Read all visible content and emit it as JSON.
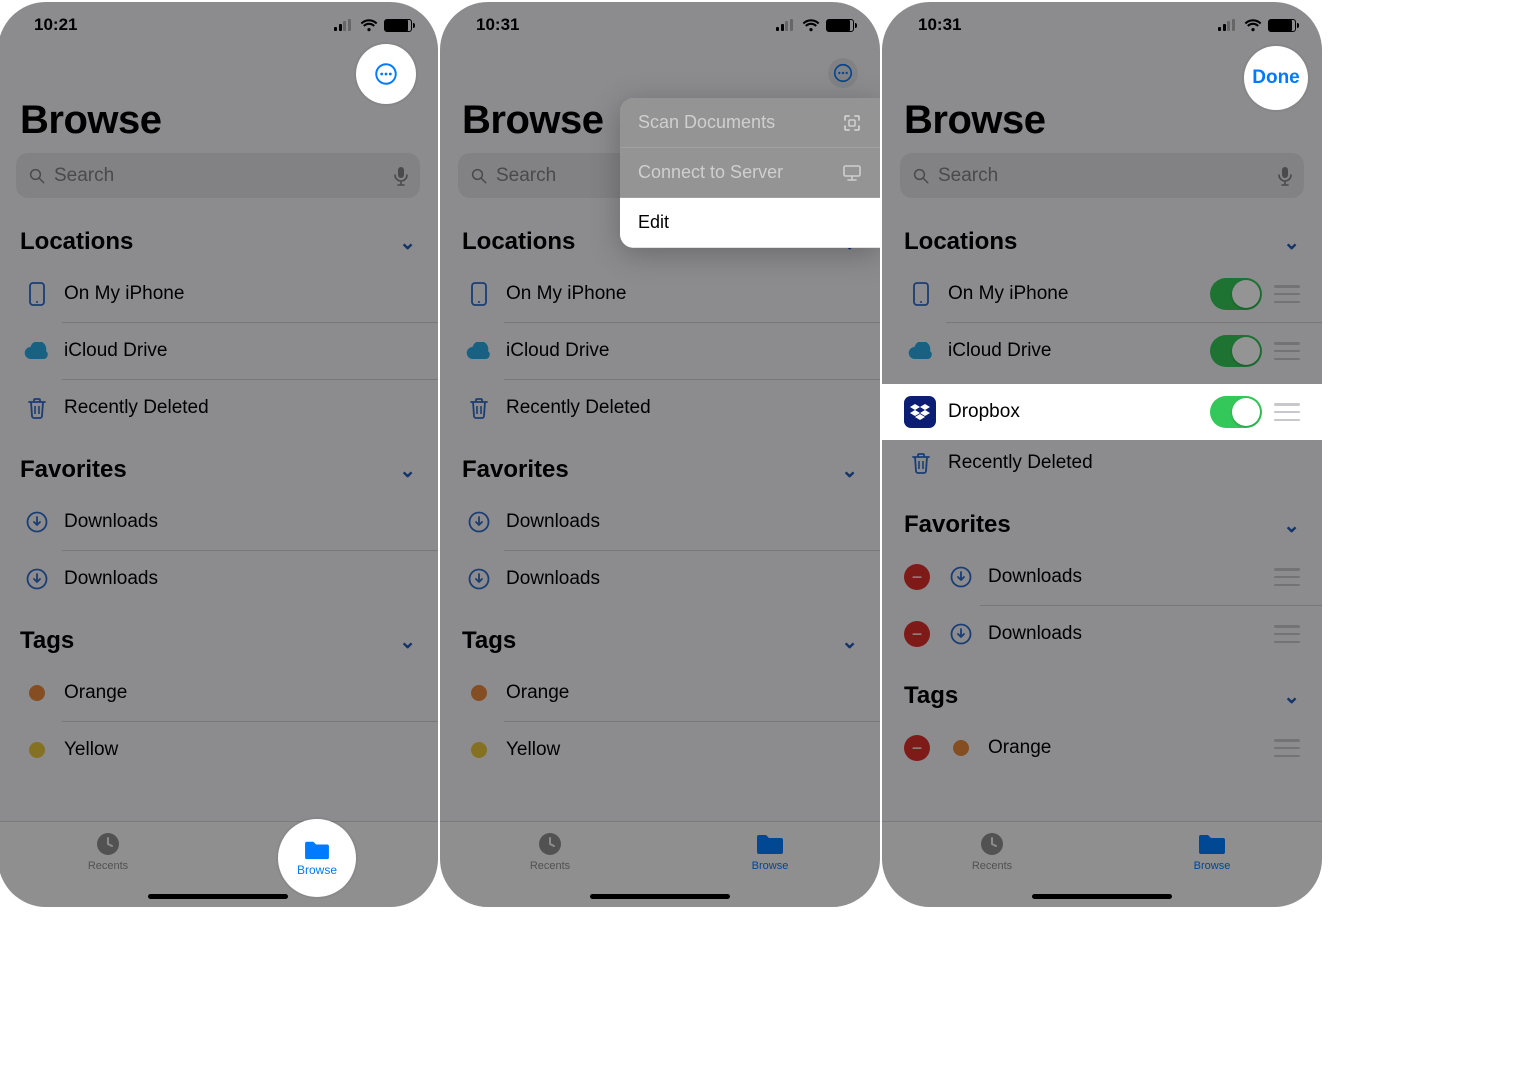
{
  "panel1": {
    "time": "10:21",
    "title": "Browse",
    "search_placeholder": "Search",
    "sections": {
      "locations": {
        "header": "Locations",
        "items": [
          {
            "label": "On My iPhone"
          },
          {
            "label": "iCloud Drive"
          },
          {
            "label": "Recently Deleted"
          }
        ]
      },
      "favorites": {
        "header": "Favorites",
        "items": [
          {
            "label": "Downloads"
          },
          {
            "label": "Downloads"
          }
        ]
      },
      "tags": {
        "header": "Tags",
        "items": [
          {
            "label": "Orange",
            "color": "#e6853c"
          },
          {
            "label": "Yellow",
            "color": "#e6c33c"
          }
        ]
      }
    },
    "tabs": {
      "recents": "Recents",
      "browse": "Browse"
    }
  },
  "panel2": {
    "time": "10:31",
    "title": "Browse",
    "search_placeholder": "Search",
    "menu": {
      "scan": "Scan Documents",
      "connect": "Connect to Server",
      "edit": "Edit"
    },
    "sections": {
      "locations": {
        "header": "Locations",
        "items": [
          {
            "label": "On My iPhone"
          },
          {
            "label": "iCloud Drive"
          },
          {
            "label": "Recently Deleted"
          }
        ]
      },
      "favorites": {
        "header": "Favorites",
        "items": [
          {
            "label": "Downloads"
          },
          {
            "label": "Downloads"
          }
        ]
      },
      "tags": {
        "header": "Tags",
        "items": [
          {
            "label": "Orange",
            "color": "#e6853c"
          },
          {
            "label": "Yellow",
            "color": "#e6c33c"
          }
        ]
      }
    },
    "tabs": {
      "recents": "Recents",
      "browse": "Browse"
    }
  },
  "panel3": {
    "time": "10:31",
    "title": "Browse",
    "done": "Done",
    "search_placeholder": "Search",
    "sections": {
      "locations": {
        "header": "Locations",
        "items": [
          {
            "label": "On My iPhone",
            "toggle": true
          },
          {
            "label": "iCloud Drive",
            "toggle": true
          },
          {
            "label": "Dropbox",
            "toggle": true
          },
          {
            "label": "Recently Deleted"
          }
        ]
      },
      "favorites": {
        "header": "Favorites",
        "items": [
          {
            "label": "Downloads"
          },
          {
            "label": "Downloads"
          }
        ]
      },
      "tags": {
        "header": "Tags",
        "items": [
          {
            "label": "Orange",
            "color": "#e6853c"
          }
        ]
      }
    },
    "tabs": {
      "recents": "Recents",
      "browse": "Browse"
    }
  }
}
